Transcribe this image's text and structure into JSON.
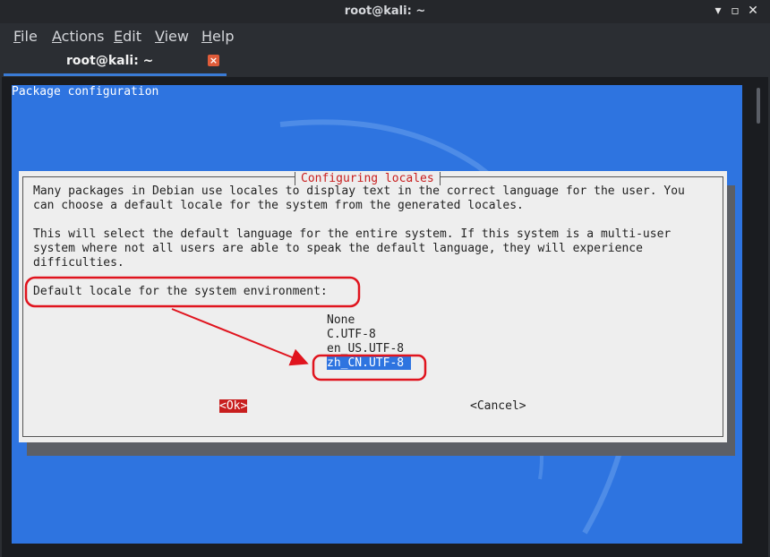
{
  "window": {
    "title": "root@kali: ~"
  },
  "menubar": [
    {
      "pre": "",
      "ul": "F",
      "post": "ile"
    },
    {
      "pre": "",
      "ul": "A",
      "post": "ctions"
    },
    {
      "pre": "",
      "ul": "E",
      "post": "dit"
    },
    {
      "pre": "",
      "ul": "V",
      "post": "iew"
    },
    {
      "pre": "",
      "ul": "H",
      "post": "elp"
    }
  ],
  "tab": {
    "label": "root@kali: ~",
    "close_glyph": "×"
  },
  "screen": {
    "header": "Package configuration",
    "dialog": {
      "title": "Configuring locales",
      "paragraph1": [
        "Many packages in Debian use locales to display text in the correct language for the user. You",
        "can choose a default locale for the system from the generated locales."
      ],
      "paragraph2": [
        "This will select the default language for the entire system. If this system is a multi-user",
        "system where not all users are able to speak the default language, they will experience",
        "difficulties."
      ],
      "prompt": "Default locale for the system environment:",
      "options": [
        "None",
        "C.UTF-8",
        "en_US.UTF-8",
        "zh_CN.UTF-8"
      ],
      "selected_option": "zh_CN.UTF-8",
      "ok_label": "<Ok>",
      "cancel_label": "<Cancel>"
    }
  },
  "colors": {
    "terminal_blue": "#2e74e0",
    "dialog_bg": "#eeeeee",
    "accent_red": "#c81e1e",
    "annotation_red": "#e0141e"
  }
}
